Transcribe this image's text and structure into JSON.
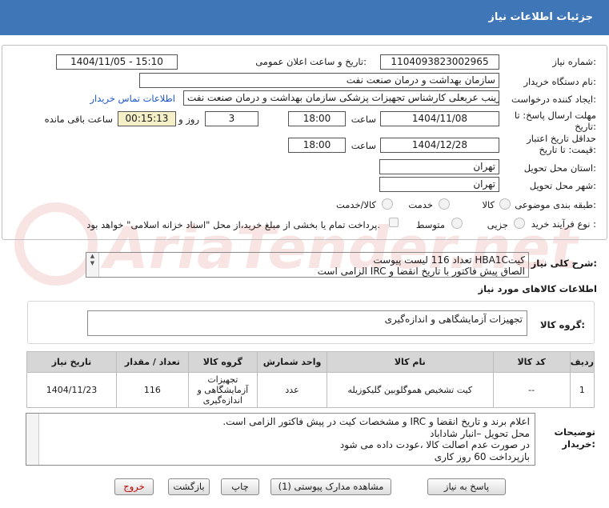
{
  "header": {
    "title": "جزئیات اطلاعات نیاز"
  },
  "fields": {
    "need_number_label": "شماره نیاز:",
    "need_number": "1104093823002965",
    "announce_label": "تاریخ و ساعت اعلان عمومی:",
    "announce_value": "1404/11/05 - 15:10",
    "buyer_org_label": "نام دستگاه خریدار:",
    "buyer_org": "سازمان بهداشت و درمان صنعت نفت",
    "creator_label": "ایجاد کننده درخواست:",
    "creator": "زینب عربعلی کارشناس تجهیزات پزشکی سازمان بهداشت و درمان صنعت نفت",
    "contact_link": "اطلاعات تماس خریدار",
    "deadline_label_1": "مهلت ارسال پاسخ: تا",
    "deadline_label_2": "تاریخ:",
    "deadline_date": "1404/11/08",
    "time_label": "ساعت",
    "deadline_time": "18:00",
    "days_value": "3",
    "days_label": "روز و",
    "remaining_time": "00:15:13",
    "remaining_label": "ساعت باقی مانده",
    "validity_label_1": "حداقل تاریخ اعتبار",
    "validity_label_2": "قیمت: تا تاریخ:",
    "validity_date": "1404/12/28",
    "validity_time_label": "ساعت",
    "validity_time": "18:00",
    "province_label": "استان محل تحویل:",
    "province": "تهران",
    "city_label": "شهر محل تحویل:",
    "city": "تهران",
    "category_label": "طبقه بندی موضوعی:",
    "category_options": [
      "کالا",
      "خدمت",
      "کالا/خدمت"
    ],
    "process_label": "نوع فرآیند خرید :",
    "process_options": [
      "جزیی",
      "متوسط"
    ],
    "payment_note": "پرداخت تمام یا بخشی از مبلغ خرید،از محل \"اسناد خزانه اسلامی\" خواهد بود."
  },
  "summary": {
    "label": "شرح کلی نیاز:",
    "line1": "کیتHBA1C  تعداد 116 لیست پیوست",
    "line2": "الصاق پیش فاکتور با تاریخ انقضا و IRC  الزامی است"
  },
  "goods_info_title": "اطلاعات کالاهای مورد نیاز",
  "goods_group": {
    "label": "گروه کالا:",
    "value": "تجهیزات آزمایشگاهی و اندازه‌گیری"
  },
  "table": {
    "headers": [
      "ردیف",
      "کد کالا",
      "نام کالا",
      "واحد شمارش",
      "گروه کالا",
      "تعداد / مقدار",
      "تاریخ نیاز"
    ],
    "rows": [
      {
        "idx": "1",
        "code": "--",
        "name": "کیت تشخیص هموگلوبین گلیکوزیله",
        "unit": "عدد",
        "group": "تجهیزات آزمایشگاهی و اندازه‌گیری",
        "qty": "116",
        "date": "1404/11/23"
      }
    ]
  },
  "notes": {
    "label_1": "توضیحات",
    "label_2": "خریدار:",
    "lines": [
      "اعلام برند و تاریخ انقضا  و IRC  و مشخصات کیت در پیش فاکتور الزامی است.",
      "محل تحویل –انبار شاداباد",
      "در صورت عدم اصالت کالا ،عودت داده می شود",
      "بازپرداخت 60 روز کاری"
    ]
  },
  "buttons": {
    "reply": "پاسخ به نیاز",
    "docs": "مشاهده مدارک پیوستی (1)",
    "print": "چاپ",
    "back": "بازگشت",
    "exit": "خروج"
  },
  "watermark": "AriaTender.net",
  "colors": {
    "header_bg": "#3e76b8",
    "link": "#1b55c4",
    "remaining_bg": "#f5f0c8",
    "exit_text": "#c00000"
  }
}
